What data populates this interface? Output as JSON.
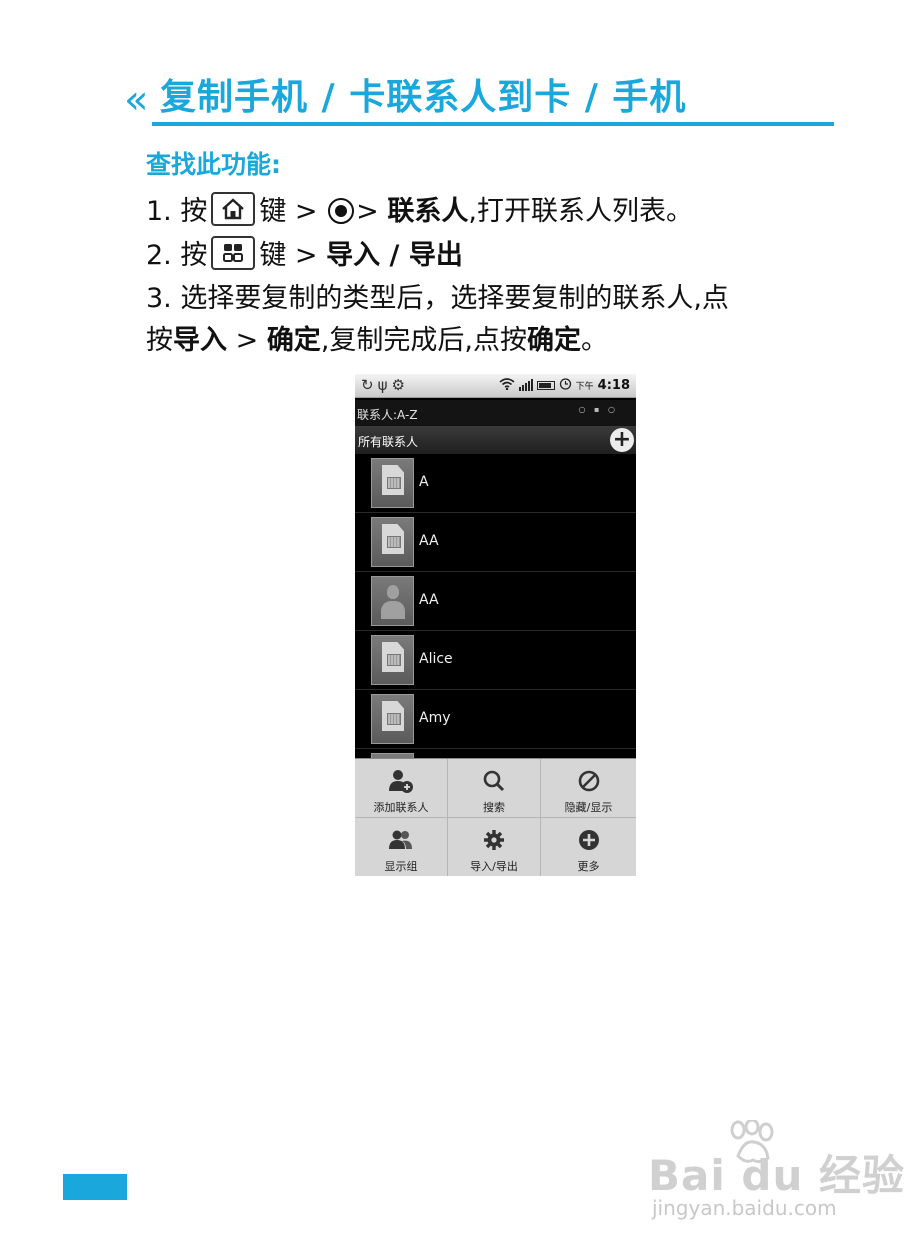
{
  "heading": {
    "chevron": "«",
    "title": "复制手机 / 卡联系人到卡 / 手机"
  },
  "find_label": "查找此功能:",
  "steps": [
    {
      "num": "1. 按",
      "key_icon": "home-key-icon",
      "after_key": "键 >",
      "circle_icon": "circle-button-icon",
      "after_circle": ">",
      "bold": "联系人",
      "rest": ",打开联系人列表。"
    },
    {
      "num": "2. 按",
      "key_icon": "menu-key-icon",
      "after_key": "键 >",
      "bold": "导入 / 导出"
    },
    {
      "line1": "3. 选择要复制的类型后，选择要复制的联系人,点",
      "line2_a": "按",
      "line2_b": "导入",
      "line2_c": ">",
      "line2_d": "确定",
      "line2_e": ",复制完成后,点按",
      "line2_f": "确定",
      "line2_g": "。"
    }
  ],
  "phone": {
    "status": {
      "left_icons": "sync usb settings",
      "ampm": "下午",
      "time": "4:18"
    },
    "header_title": "联系人:A-Z",
    "header_dots": "○ ▪ ○",
    "group_title": "所有联系人",
    "group_add": "+",
    "contacts": [
      {
        "name": "A",
        "avatar": "sim-card-icon"
      },
      {
        "name": "AA",
        "avatar": "sim-card-icon"
      },
      {
        "name": "AA",
        "avatar": "person-icon"
      },
      {
        "name": "Alice",
        "avatar": "sim-card-icon"
      },
      {
        "name": "Amy",
        "avatar": "sim-card-icon"
      }
    ],
    "menu": [
      {
        "label": "添加联系人",
        "icon": "add-contact-icon"
      },
      {
        "label": "搜索",
        "icon": "search-icon"
      },
      {
        "label": "隐藏/显示",
        "icon": "hide-show-icon"
      },
      {
        "label": "显示组",
        "icon": "groups-icon"
      },
      {
        "label": "导入/导出",
        "icon": "gear-icon"
      },
      {
        "label": "更多",
        "icon": "more-icon"
      }
    ]
  },
  "watermark": {
    "logo": "Bai du 经验",
    "url": "jingyan.baidu.com"
  },
  "colors": {
    "accent": "#1aa8dc"
  }
}
